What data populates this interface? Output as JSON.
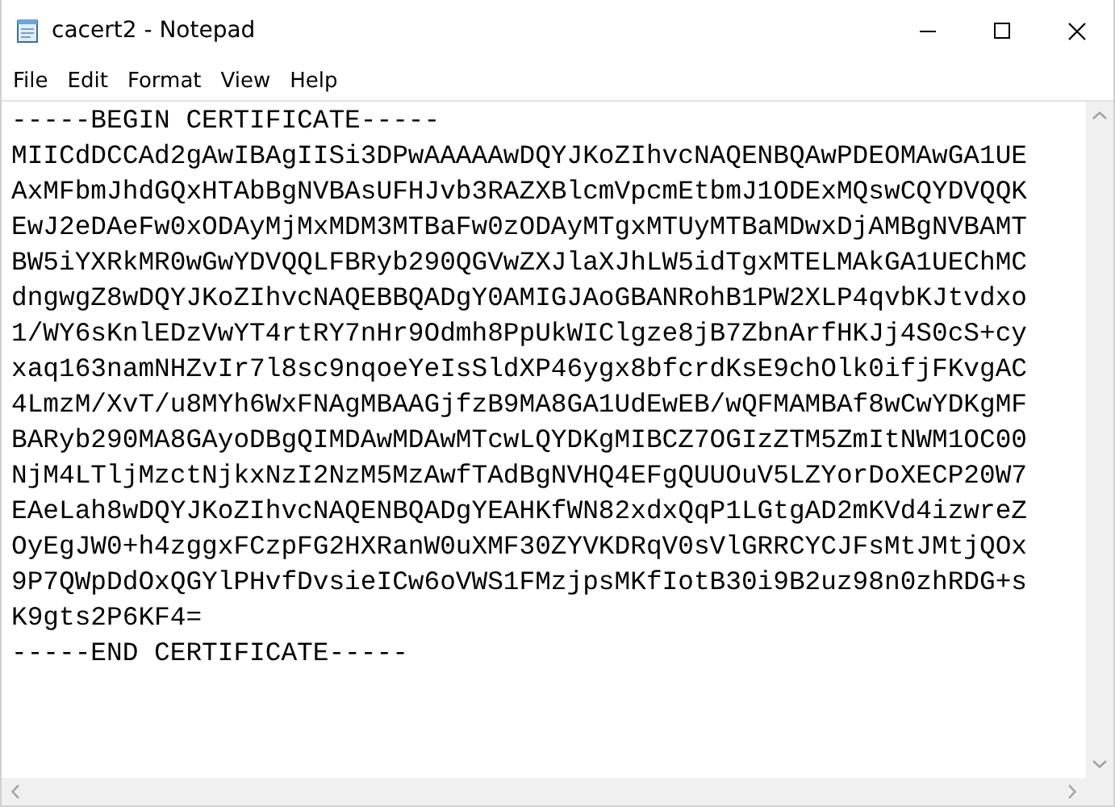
{
  "window": {
    "title": "cacert2 - Notepad"
  },
  "menu": [
    "File",
    "Edit",
    "Format",
    "View",
    "Help"
  ],
  "document": {
    "lines": [
      "-----BEGIN CERTIFICATE-----",
      "MIICdDCCAd2gAwIBAgIISi3DPwAAAAAwDQYJKoZIhvcNAQENBQAwPDEOMAwGA1UE",
      "AxMFbmJhdGQxHTAbBgNVBAsUFHJvb3RAZXBlcmVpcmEtbmJ1ODExMQswCQYDVQQK",
      "EwJ2eDAeFw0xODAyMjMxMDM3MTBaFw0zODAyMTgxMTUyMTBaMDwxDjAMBgNVBAMT",
      "BW5iYXRkMR0wGwYDVQQLFBRyb290QGVwZXJlaXJhLW5idTgxMTELMAkGA1UEChMC",
      "dngwgZ8wDQYJKoZIhvcNAQEBBQADgY0AMIGJAoGBANRohB1PW2XLP4qvbKJtvdxo",
      "1/WY6sKnlEDzVwYT4rtRY7nHr9Odmh8PpUkWIClgze8jB7ZbnArfHKJj4S0cS+cy",
      "xaq163namNHZvIr7l8sc9nqoeYeIsSldXP46ygx8bfcrdKsE9chOlk0ifjFKvgAC",
      "4LmzM/XvT/u8MYh6WxFNAgMBAAGjfzB9MA8GA1UdEwEB/wQFMAMBAf8wCwYDKgMF",
      "BARyb290MA8GAyoDBgQIMDAwMDAwMTcwLQYDKgMIBCZ7OGIzZTM5ZmItNWM1OC00",
      "NjM4LTljMzctNjkxNzI2NzM5MzAwfTAdBgNVHQ4EFgQUUOuV5LZYorDoXECP20W7",
      "EAeLah8wDQYJKoZIhvcNAQENBQADgYEAHKfWN82xdxQqP1LGtgAD2mKVd4izwreZ",
      "OyEgJW0+h4zggxFCzpFG2HXRanW0uXMF30ZYVKDRqV0sVlGRRCYCJFsMtJMtjQOx",
      "9P7QWpDdOxQGYlPHvfDvsieICw6oVWS1FMzjpsMKfIotB30i9B2uz98n0zhRDG+s",
      "K9gts2P6KF4=",
      "-----END CERTIFICATE-----"
    ]
  }
}
